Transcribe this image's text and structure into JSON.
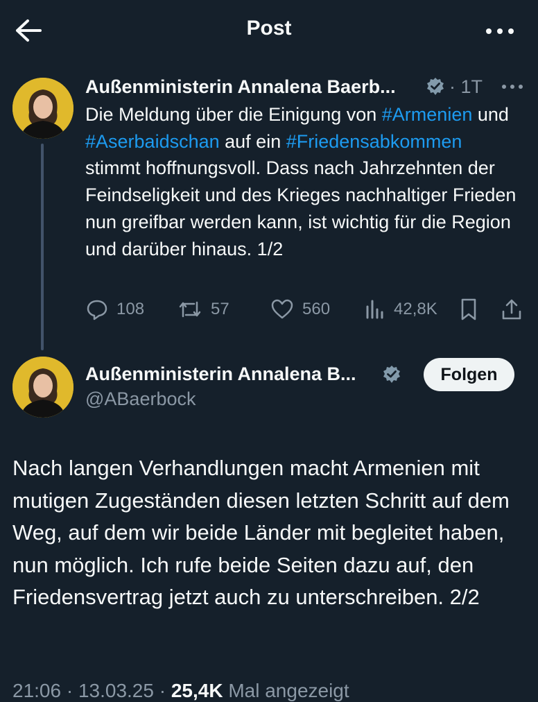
{
  "header": {
    "title": "Post",
    "back_icon": "arrow-left-icon",
    "more_icon": "more-horizontal-icon"
  },
  "tweet1": {
    "author_name": "Außenministerin Annalena Baerb...",
    "time": "· 1T",
    "segments": [
      {
        "text": "Die Meldung über die Einigung von ",
        "link": false
      },
      {
        "text": "#Armenien",
        "link": true
      },
      {
        "text": " und ",
        "link": false
      },
      {
        "text": "#Aserbaidschan",
        "link": true
      },
      {
        "text": " auf ein ",
        "link": false
      },
      {
        "text": "#Friedensabkommen",
        "link": true
      },
      {
        "text": " stimmt hoffnungsvoll. Dass nach Jahrzehnten der Feindseligkeit und des Krieges nachhaltiger Frieden nun greifbar werden kann, ist wichtig für die Region und darüber hinaus. 1/2",
        "link": false
      }
    ],
    "actions": {
      "replies": "108",
      "reposts": "57",
      "likes": "560",
      "views": "42,8K"
    }
  },
  "tweet2": {
    "author_name": "Außenministerin Annalena B...",
    "handle": "@ABaerbock",
    "follow_label": "Folgen",
    "text": "Nach langen Verhandlungen macht Armenien mit mutigen Zugeständen diesen letzten Schritt auf dem Weg, auf dem wir beide Länder mit begleitet haben, nun möglich. Ich rufe beide Seiten dazu auf, den Friedensvertrag jetzt auch zu unterschreiben. 2/2",
    "footer": {
      "time": "21:06 · 13.03.25 · ",
      "views": "25,4K",
      "views_label": " Mal angezeigt"
    }
  },
  "colors": {
    "background": "#15202b",
    "link": "#1d9bf0",
    "muted": "#8b98a5",
    "verified": "#829aab",
    "avatar_bg": "#e0b92c"
  }
}
